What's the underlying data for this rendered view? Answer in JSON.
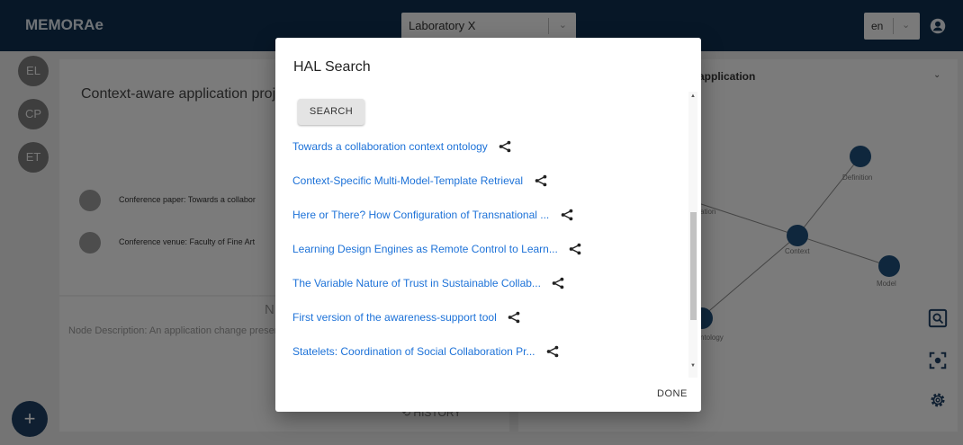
{
  "header": {
    "app_name": "MEMORAe",
    "lab_select": "Laboratory X",
    "lang_select": "en"
  },
  "sidebar": {
    "badges": [
      "EL",
      "CP",
      "ET"
    ],
    "add_label": "+"
  },
  "left_panel": {
    "title": "Context-aware application proj",
    "items": [
      {
        "label": "Conference paper: Towards a collabor"
      },
      {
        "label": "Conference venue: Faculty of Fine Art"
      }
    ]
  },
  "description_panel": {
    "heading": "N",
    "text": "Node Description: An application change present context: their location, who they so c",
    "history_label": "HISTORY"
  },
  "right_panel": {
    "title": "application",
    "graph_labels": {
      "definition": "Definition",
      "context": "Context",
      "model": "Model",
      "ation": "ation",
      "ontology": "ntology"
    }
  },
  "dialog": {
    "title": "HAL Search",
    "search_label": "SEARCH",
    "done_label": "DONE",
    "results": [
      "Towards a collaboration context ontology",
      "Context-Specific Multi-Model-Template Retrieval",
      "Here or There? How Configuration of Transnational ...",
      "Learning Design Engines as Remote Control to Learn...",
      "The Variable Nature of Trust in Sustainable Collab...",
      "First version of the awareness-support tool",
      "Statelets: Coordination of Social Collaboration Pr..."
    ]
  },
  "colors": {
    "topbar": "#0f2f4e",
    "link": "#1d72d8",
    "node": "#1f4f7a"
  },
  "icons": [
    "user-icon",
    "chevron-down-icon",
    "share-icon",
    "zoom-fit-icon",
    "focus-icon",
    "settings-icon",
    "history-icon",
    "add-icon"
  ]
}
